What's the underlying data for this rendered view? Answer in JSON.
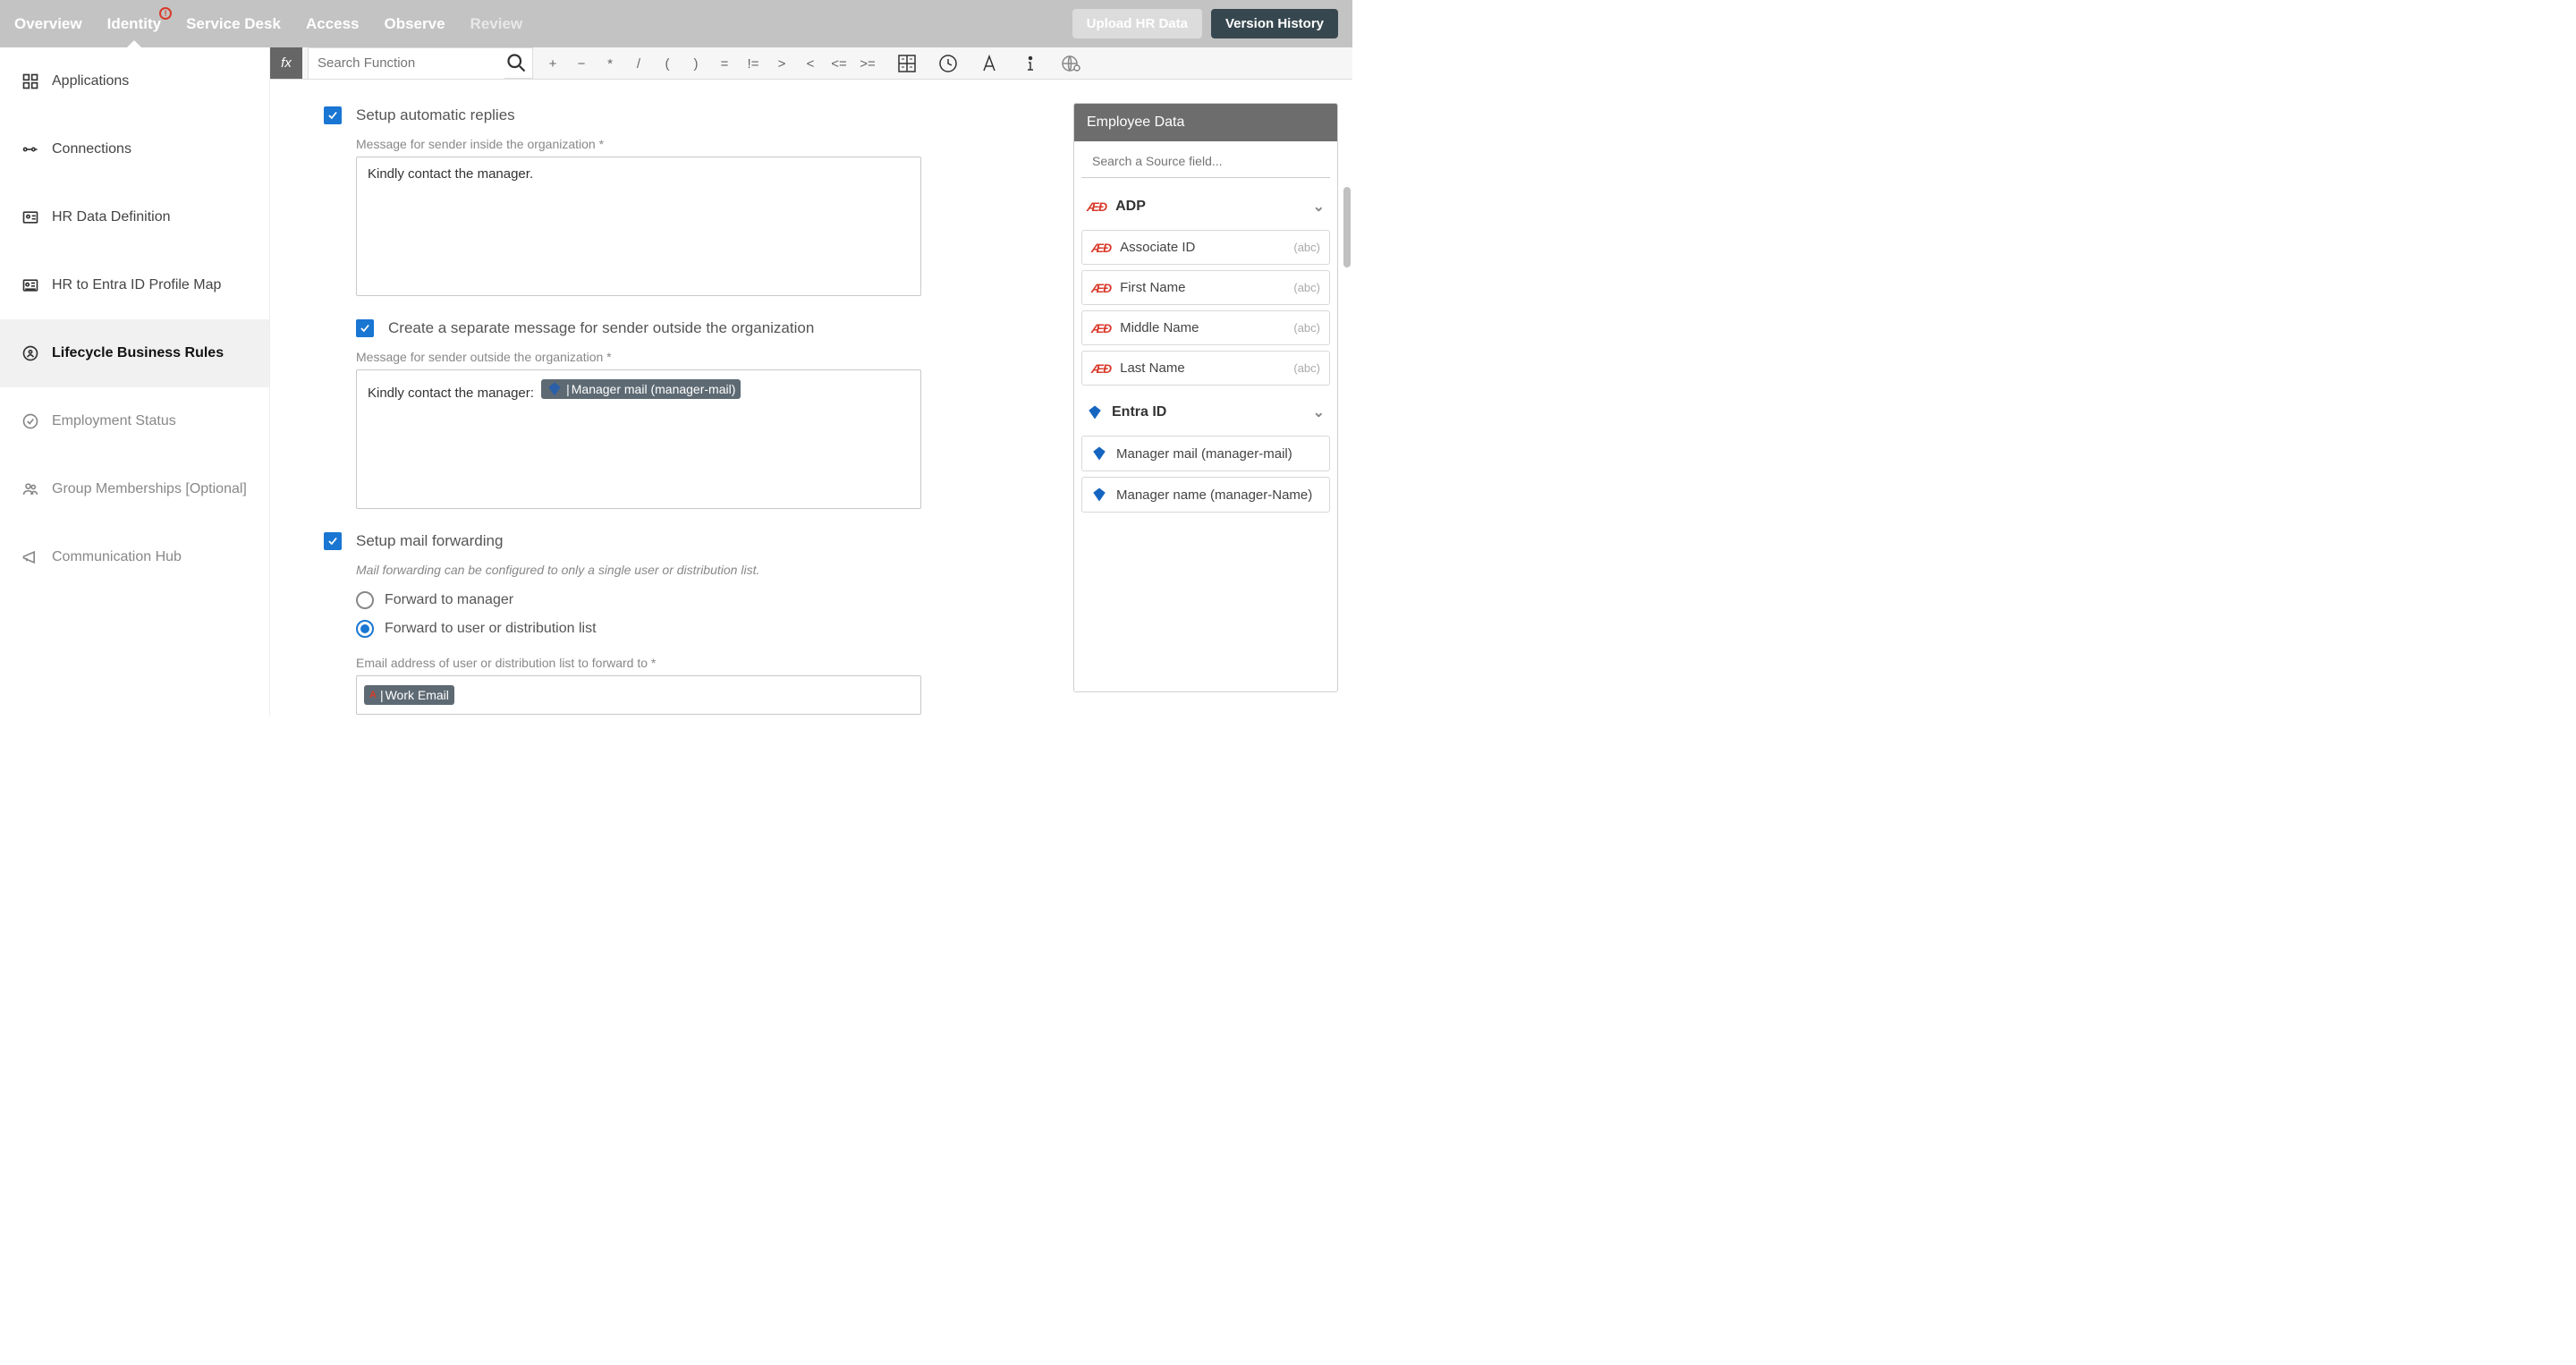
{
  "topnav": {
    "tabs": [
      "Overview",
      "Identity",
      "Service Desk",
      "Access",
      "Observe",
      "Review"
    ],
    "active": "Identity",
    "upload": "Upload HR Data",
    "version": "Version History"
  },
  "sidebar": {
    "items": [
      "Applications",
      "Connections",
      "HR Data Definition",
      "HR to Entra ID Profile Map",
      "Lifecycle Business Rules",
      "Employment Status",
      "Group Memberships [Optional]",
      "Communication Hub"
    ],
    "active_index": 4
  },
  "formula": {
    "fx": "fx",
    "search_placeholder": "Search Function",
    "ops": [
      "+",
      "−",
      "*",
      "/",
      "(",
      ")",
      "=",
      "!=",
      ">",
      "<",
      "<=",
      ">="
    ]
  },
  "form": {
    "auto_reply": {
      "label": "Setup automatic replies",
      "inside_label": "Message for sender inside the organization *",
      "inside_value": "Kindly contact the manager.",
      "separate_label": "Create a separate message for sender outside the organization",
      "outside_label": "Message for sender outside the organization *",
      "outside_prefix": "Kindly contact the manager: ",
      "outside_tag": "Manager mail (manager-mail)"
    },
    "forwarding": {
      "label": "Setup mail forwarding",
      "help": "Mail forwarding can be configured to only a single user or distribution list.",
      "opt1": "Forward to manager",
      "opt2": "Forward to user or distribution list",
      "email_label": "Email address of user or distribution list to forward to *",
      "email_tag": "Work Email"
    }
  },
  "panel": {
    "title": "Employee Data",
    "search_placeholder": "Search a Source field...",
    "adp": {
      "name": "ADP",
      "fields": [
        {
          "name": "Associate ID",
          "type": "(abc)"
        },
        {
          "name": "First Name",
          "type": "(abc)"
        },
        {
          "name": "Middle Name",
          "type": "(abc)"
        },
        {
          "name": "Last Name",
          "type": "(abc)"
        }
      ]
    },
    "entra": {
      "name": "Entra ID",
      "fields": [
        {
          "name": "Manager mail (manager-mail)"
        },
        {
          "name": "Manager name (manager-Name)"
        }
      ]
    }
  }
}
